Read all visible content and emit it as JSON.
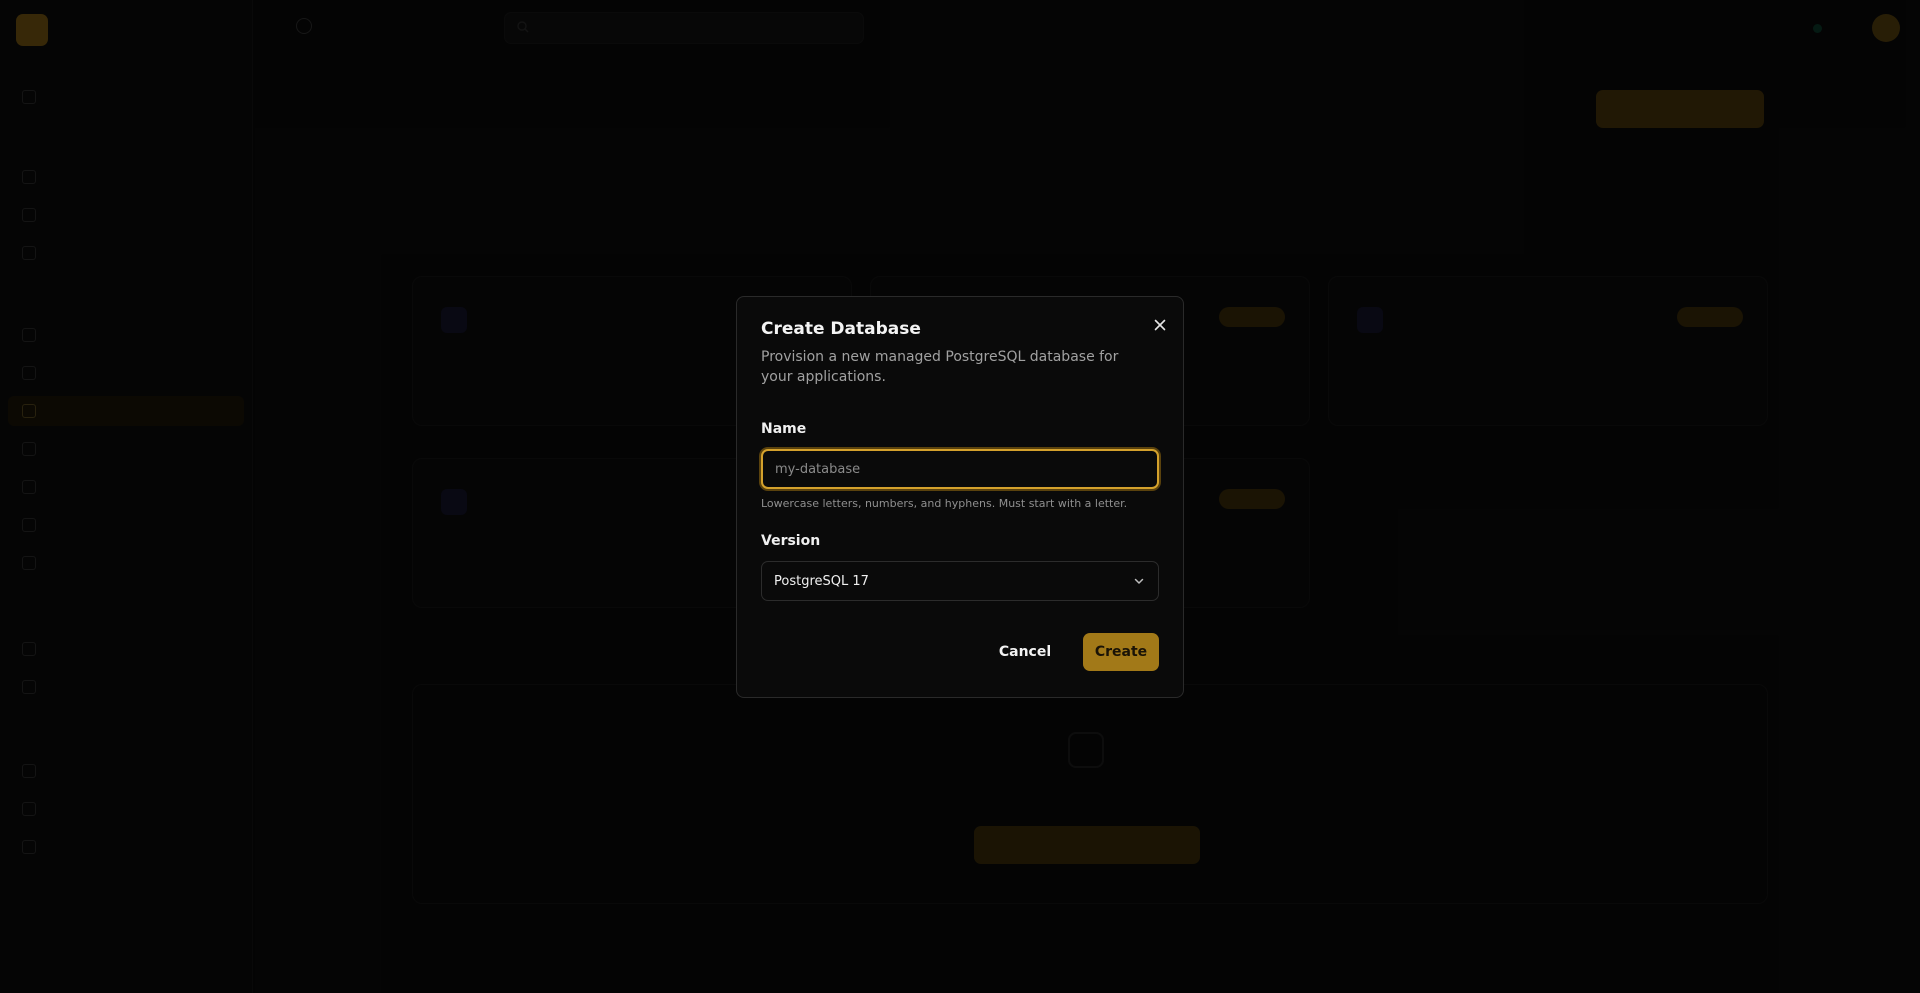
{
  "colors": {
    "accent": "#d4a12c",
    "create_button": "#a27918",
    "dialog_bg": "#0a0a0a",
    "page_bg": "#0b0b0b"
  },
  "dialog": {
    "title": "Create Database",
    "description": "Provision a new managed PostgreSQL database for your applications.",
    "close_icon": "close-icon",
    "name": {
      "label": "Name",
      "value": "",
      "placeholder": "my-database",
      "hint": "Lowercase letters, numbers, and hyphens. Must start with a letter."
    },
    "version": {
      "label": "Version",
      "selected": "PostgreSQL 17",
      "icon": "chevron-down-icon"
    },
    "cancel_label": "Cancel",
    "create_label": "Create"
  }
}
